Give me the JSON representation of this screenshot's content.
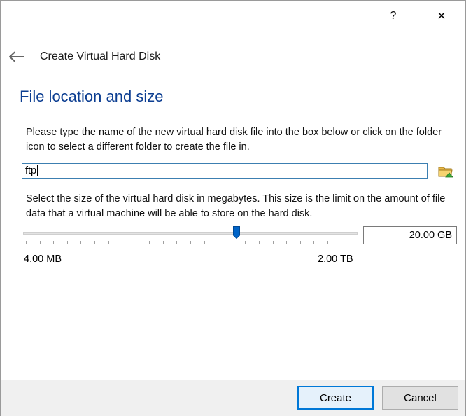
{
  "titlebar": {
    "help_label": "?",
    "close_label": "✕"
  },
  "header": {
    "wizard_title": "Create Virtual Hard Disk",
    "heading": "File location and size"
  },
  "file": {
    "description": "Please type the name of the new virtual hard disk file into the box below or click on the folder icon to select a different folder to create the file in.",
    "value": "ftp"
  },
  "size": {
    "description": "Select the size of the virtual hard disk in megabytes. This size is the limit on the amount of file data that a virtual machine will be able to store on the hard disk.",
    "value": "20.00 GB",
    "min_label": "4.00 MB",
    "max_label": "2.00 TB",
    "slider_fraction": 0.64,
    "tick_count": 25
  },
  "footer": {
    "create_label": "Create",
    "cancel_label": "Cancel"
  },
  "colors": {
    "heading": "#0b3d91",
    "accent": "#0078d7",
    "thumb": "#0064c8"
  },
  "icons": {
    "back": "arrow-left-icon",
    "folder": "folder-icon",
    "help": "help-icon",
    "close": "close-icon"
  }
}
